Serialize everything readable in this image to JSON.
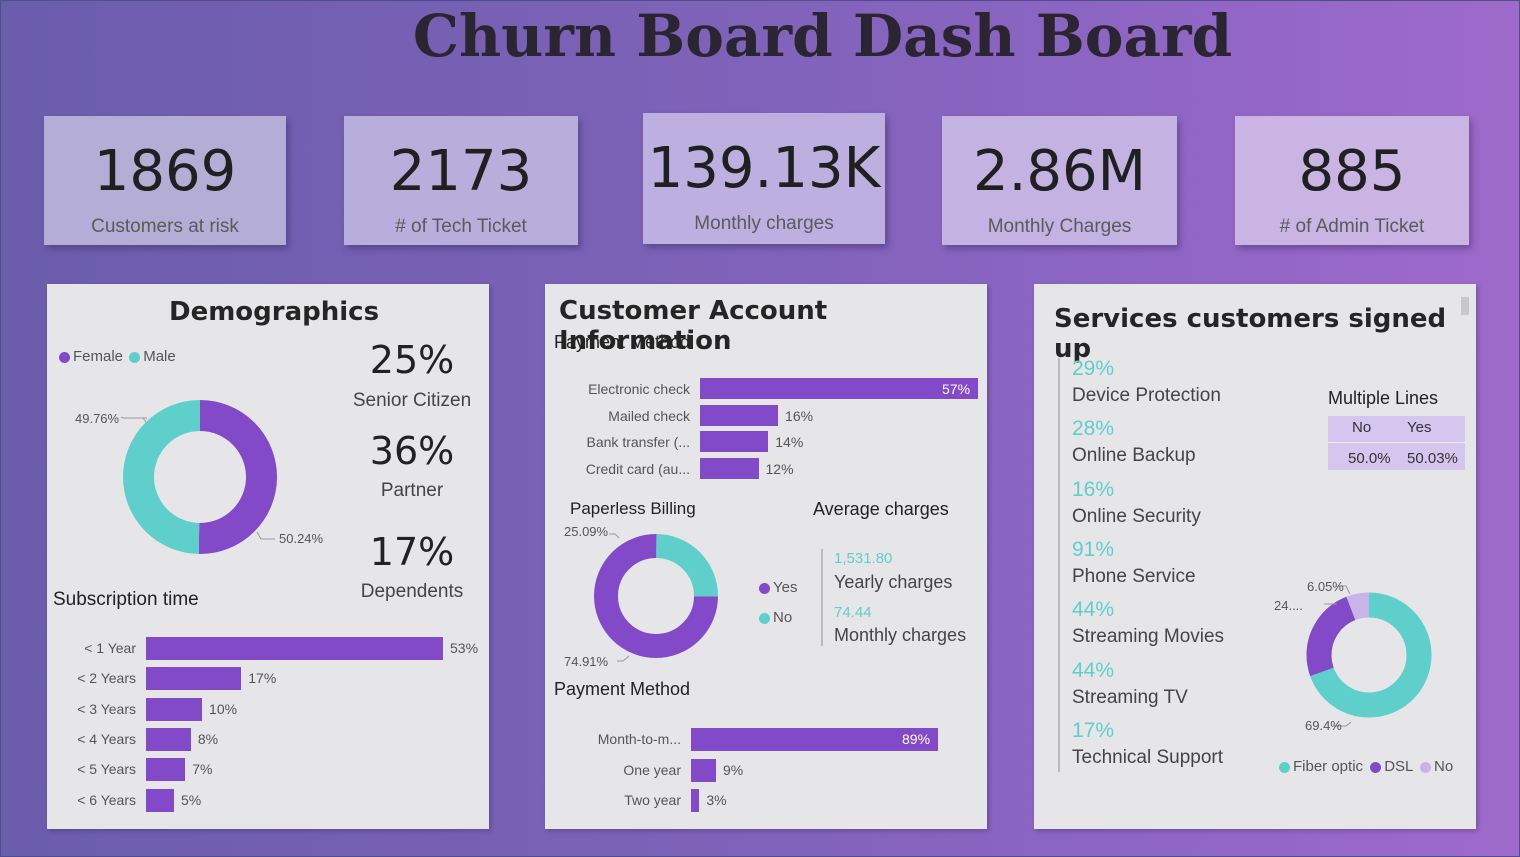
{
  "title": "Churn Board Dash Board",
  "colors": {
    "purple": "#8249c8",
    "teal": "#5ecfcb",
    "lavender": "#c8b4e8",
    "panel": "#e6e6e8"
  },
  "kpis": [
    {
      "value": "1869",
      "label": "Customers at risk"
    },
    {
      "value": "2173",
      "label": "# of Tech Ticket"
    },
    {
      "value": "139.13K",
      "label": "Monthly charges"
    },
    {
      "value": "2.86M",
      "label": "Monthly Charges"
    },
    {
      "value": "885",
      "label": "# of Admin Ticket"
    }
  ],
  "demographics": {
    "title": "Demographics",
    "legend": [
      "Female",
      "Male"
    ],
    "gender_labels": {
      "male": "49.76%",
      "female": "50.24%"
    },
    "stats": [
      {
        "value": "25%",
        "label": "Senior Citizen"
      },
      {
        "value": "36%",
        "label": "Partner"
      },
      {
        "value": "17%",
        "label": "Dependents"
      }
    ],
    "subscription_title": "Subscription time"
  },
  "account": {
    "title": "Customer Account Information",
    "payment_title": "Payment Method",
    "paperless_title": "Paperless Billing",
    "paperless_labels": {
      "yes": "74.91%",
      "no": "25.09%"
    },
    "legend": [
      "Yes",
      "No"
    ],
    "avg_title": "Average charges",
    "yearly_value": "1,531.80",
    "yearly_label": "Yearly charges",
    "monthly_value": "74.44",
    "monthly_label": "Monthly charges",
    "contract_title": "Payment Method"
  },
  "services": {
    "title": "Services customers signed up",
    "items": [
      {
        "pct": "29%",
        "label": "Device Protection"
      },
      {
        "pct": "28%",
        "label": "Online Backup"
      },
      {
        "pct": "16%",
        "label": "Online Security"
      },
      {
        "pct": "91%",
        "label": "Phone Service"
      },
      {
        "pct": "44%",
        "label": "Streaming Movies"
      },
      {
        "pct": "44%",
        "label": "Streaming TV"
      },
      {
        "pct": "17%",
        "label": "Technical Support"
      }
    ],
    "multiple_lines": {
      "title": "Multiple Lines",
      "headers": [
        "No",
        "Yes"
      ],
      "values": [
        "50.0%",
        "50.03%"
      ]
    },
    "internet_legend": [
      "Fiber optic",
      "DSL",
      "No"
    ],
    "internet_labels": {
      "fiber": "69.4%",
      "dsl": "24....",
      "no": "6.05%"
    }
  },
  "chart_data": [
    {
      "type": "pie",
      "title": "",
      "categories": [
        "Female",
        "Male"
      ],
      "values": [
        50.24,
        49.76
      ]
    },
    {
      "type": "bar",
      "title": "Subscription time",
      "categories": [
        "< 1 Year",
        "< 2 Years",
        "< 3 Years",
        "< 4 Years",
        "< 5 Years",
        "< 6 Years"
      ],
      "values": [
        53,
        17,
        10,
        8,
        7,
        5
      ],
      "labels": [
        "53%",
        "17%",
        "10%",
        "8%",
        "7%",
        "5%"
      ]
    },
    {
      "type": "bar",
      "title": "Payment Method",
      "categories": [
        "Electronic check",
        "Mailed check",
        "Bank transfer (...",
        "Credit card (au..."
      ],
      "values": [
        57,
        16,
        14,
        12
      ],
      "labels": [
        "57%",
        "16%",
        "14%",
        "12%"
      ]
    },
    {
      "type": "pie",
      "title": "Paperless Billing",
      "categories": [
        "Yes",
        "No"
      ],
      "values": [
        74.91,
        25.09
      ]
    },
    {
      "type": "bar",
      "title": "Payment Method",
      "categories": [
        "Month-to-m...",
        "One year",
        "Two year"
      ],
      "values": [
        89,
        9,
        3
      ],
      "labels": [
        "89%",
        "9%",
        "3%"
      ]
    },
    {
      "type": "pie",
      "title": "",
      "categories": [
        "Fiber optic",
        "DSL",
        "No"
      ],
      "values": [
        69.4,
        24.55,
        6.05
      ]
    }
  ]
}
